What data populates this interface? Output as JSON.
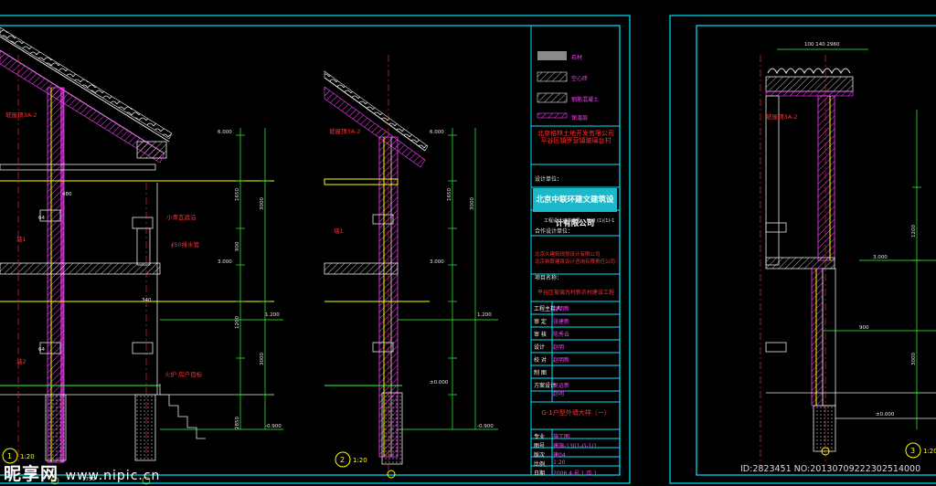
{
  "legend": [
    {
      "label": "石材",
      "pattern": "stone"
    },
    {
      "label": "空心砖",
      "pattern": "hollow-brick"
    },
    {
      "label": "钢筋混凝土",
      "pattern": "concrete"
    },
    {
      "label": "保温层",
      "pattern": "insulation"
    }
  ],
  "titleblock": {
    "client": "北京格林土地开发有限公司\n平谷区镇罗营镇玻璃台村",
    "design_unit_label": "设计单位：",
    "company": "北京中联环建文建筑设计有限公司",
    "cert": "工程设计证书编号：  甲级 (1)(1)-1",
    "coop_label": "合作设计单位：",
    "coop": "北京久建筑规划设计有限公司\n北京新联建筑设计咨询有限责任公司",
    "project_label": "项目名称：",
    "project": "平谷区玻璃台村新农村建设工程",
    "roles": [
      {
        "k": "工程主持人",
        "v": "赵明新"
      },
      {
        "k": "审 定",
        "v": "张建新"
      },
      {
        "k": "审 核",
        "v": "陈秀云"
      },
      {
        "k": "设计",
        "v": "赵明"
      },
      {
        "k": "校 对",
        "v": "赵明新"
      },
      {
        "k": "制 图",
        "v": ""
      },
      {
        "k": "方案设计",
        "v": "吴远新\n赵明"
      }
    ],
    "drawing_title": "G-1户型外墙大样（一）",
    "meta": [
      {
        "k": "专业",
        "v": "施工图"
      },
      {
        "k": "图号",
        "v": "建施-1301-G-1/1"
      },
      {
        "k": "版次",
        "v": "建04"
      },
      {
        "k": "比例",
        "v": "1:20"
      },
      {
        "k": "日期",
        "v": "2006.4  号 1 页 1"
      }
    ]
  },
  "drawing_labels": {
    "roof_left": "坡屋顶3A-2",
    "roof_mid": "坡屋顶3A-2",
    "roof_right": "坡屋顶3A-2",
    "window_sill": "小青瓦遮沿",
    "drain": "∮50排水管",
    "fire_label": "火炉·房户目标",
    "wall1": "墙1",
    "wall1b": "墙1",
    "wall2": "墙2",
    "section1": "1",
    "section1_scale": "1:20",
    "section2": "2",
    "section2_scale": "1:20",
    "section3": "3",
    "section3_scale": "1:20"
  },
  "dimensions": {
    "mid_top": "6.000",
    "mid_3000": "3.000",
    "mid_6000": "±0.000",
    "mid_1200": "1.200",
    "left_6000": "6.000",
    "left_3000": "3.000",
    "left_1200": "1.200",
    "left_neg": "-0.900",
    "right_3000": "3.000",
    "right_900": "900",
    "right_top": "100  140  2960",
    "v_1650": "1650",
    "v_900": "900",
    "v_1200": "1200",
    "v_3000": "3000",
    "v_2850": "2850",
    "h_480": "480",
    "h_340": "340",
    "h_64": "64",
    "h_1750": "1750",
    "ground": "±0.000"
  },
  "watermark": {
    "brand": "昵享网",
    "url": "www.nipic.cn",
    "id": "ID:2823451 NO:20130709222302514000"
  },
  "colors": {
    "frame": "#00e5ff",
    "yellow": "#ffff00",
    "magenta": "#ff40ff",
    "green": "#33ff33",
    "white": "#e8e8e8",
    "red": "#ff3030"
  }
}
